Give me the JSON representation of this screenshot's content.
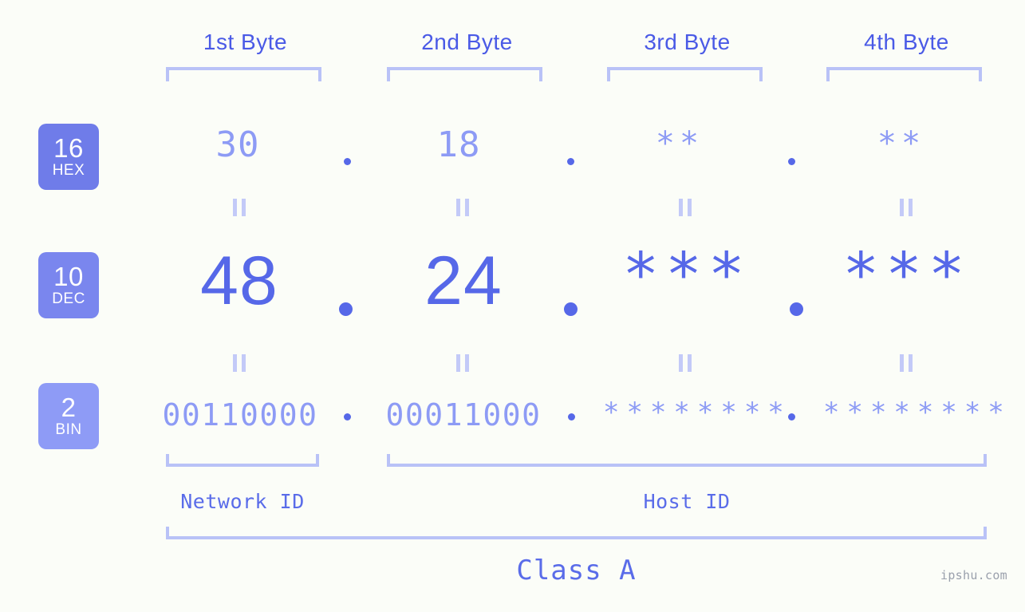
{
  "meta": {
    "site_watermark": "ipshu.com",
    "background_color": "#fbfdf8",
    "accent_color": "#5668e8",
    "accent_light_color": "#8d9bf5",
    "bracket_color": "#b9c2f7"
  },
  "header": {
    "byte_labels": [
      "1st Byte",
      "2nd Byte",
      "3rd Byte",
      "4th Byte"
    ]
  },
  "bases": [
    {
      "number": "16",
      "name": "HEX"
    },
    {
      "number": "10",
      "name": "DEC"
    },
    {
      "number": "2",
      "name": "BIN"
    }
  ],
  "rows": {
    "hex": {
      "base_number": "16",
      "base_name": "HEX",
      "values": [
        "30",
        "18",
        "**",
        "**"
      ],
      "separator": "."
    },
    "dec": {
      "base_number": "10",
      "base_name": "DEC",
      "values": [
        "48",
        "24",
        "***",
        "***"
      ],
      "separator": "."
    },
    "bin": {
      "base_number": "2",
      "base_name": "BIN",
      "values": [
        "00110000",
        "00011000",
        "********",
        "********"
      ],
      "separator": "."
    }
  },
  "equality_marks": {
    "hex_to_dec": [
      "॥",
      "॥",
      "॥",
      "॥"
    ],
    "dec_to_bin": [
      "॥",
      "॥",
      "॥",
      "॥"
    ]
  },
  "footer": {
    "network_id_label": "Network ID",
    "host_id_label": "Host ID",
    "class_label": "Class A"
  }
}
